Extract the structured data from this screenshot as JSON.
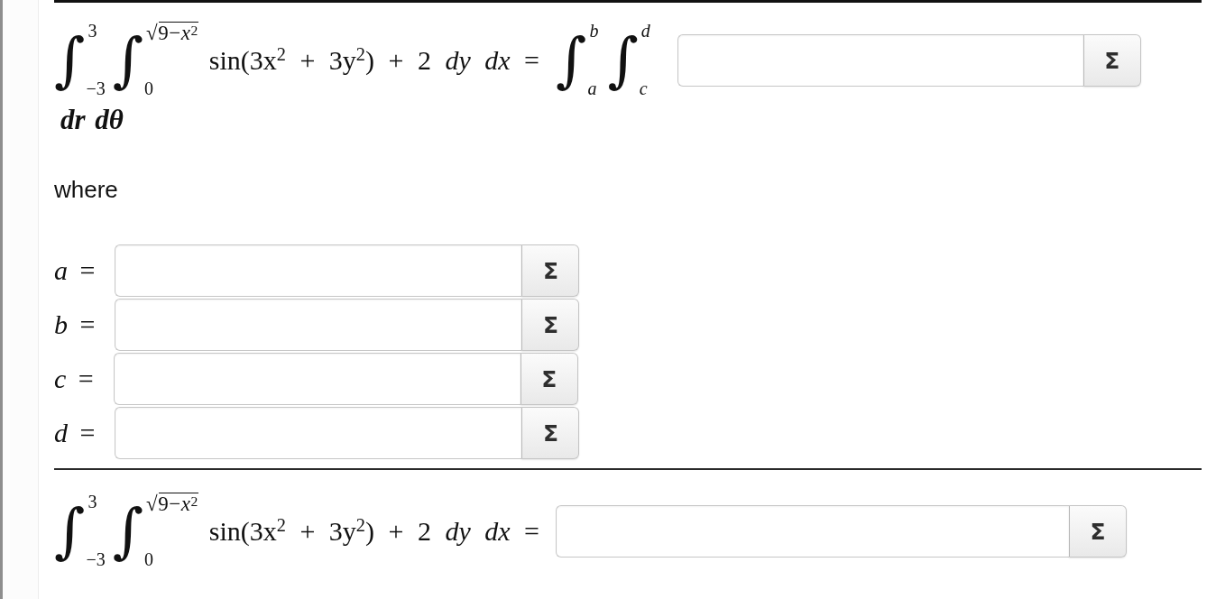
{
  "top_equation": {
    "integrals": [
      {
        "sign": "∫",
        "upper": {
          "kind": "number",
          "text": "3"
        },
        "lower": {
          "kind": "number",
          "text": "−3"
        }
      },
      {
        "sign": "∫",
        "upper": {
          "kind": "radical",
          "text": "√9−*x*$^{2}$"
        },
        "lower": {
          "kind": "number",
          "text": "0"
        }
      }
    ],
    "integrand": "sin(3x$^{2}$ + 3y$^{2}$) + 2 *dy dx* =",
    "rhs_integrals": [
      {
        "sign": "∫",
        "upper": {
          "kind": "variable",
          "text": "b"
        },
        "lower": {
          "kind": "variable",
          "text": "a"
        }
      },
      {
        "sign": "∫",
        "upper": {
          "kind": "variable",
          "text": "d"
        },
        "lower": {
          "kind": "variable",
          "text": "c"
        }
      }
    ],
    "answer_field": {
      "button": "Σ"
    },
    "differentials": "dr dθ"
  },
  "where_label": "where",
  "variables": [
    {
      "label": "*a* =",
      "button": "Σ"
    },
    {
      "label": "*b* =",
      "button": "Σ"
    },
    {
      "label": "*c* =",
      "button": "Σ"
    },
    {
      "label": "*d* =",
      "button": "Σ"
    }
  ],
  "bottom_equation": {
    "integrals": [
      {
        "sign": "∫",
        "upper": {
          "kind": "number",
          "text": "3"
        },
        "lower": {
          "kind": "number",
          "text": "−3"
        }
      },
      {
        "sign": "∫",
        "upper": {
          "kind": "radical",
          "text": "√9−*x*$^{2}$"
        },
        "lower": {
          "kind": "number",
          "text": "0"
        }
      }
    ],
    "integrand": "sin(3x$^{2}$ + 3y$^{2}$) + 2 *dy dx* =",
    "answer_field": {
      "button": "Σ"
    }
  }
}
